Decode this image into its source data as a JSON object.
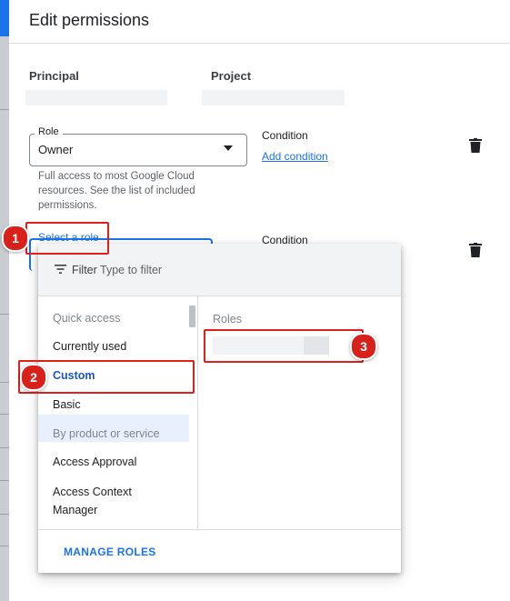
{
  "dialog": {
    "title": "Edit permissions"
  },
  "columns": {
    "principal": "Principal",
    "project": "Project"
  },
  "binding1": {
    "role_label": "Role",
    "role_value": "Owner",
    "helper_text": "Full access to most Google Cloud resources. See the list of included permissions.",
    "condition_label": "Condition",
    "add_condition": "Add condition"
  },
  "binding2": {
    "select_role": "Select a role",
    "condition_label": "Condition"
  },
  "role_picker": {
    "filter_label": "Filter",
    "filter_placeholder": "Type to filter",
    "left_items": [
      {
        "label": "Quick access",
        "type": "section"
      },
      {
        "label": "Currently used",
        "type": "item"
      },
      {
        "label": "Custom",
        "type": "item",
        "selected": true
      },
      {
        "label": "Basic",
        "type": "item"
      },
      {
        "label": "By product or service",
        "type": "section"
      },
      {
        "label": "Access Approval",
        "type": "item"
      },
      {
        "label": "Access Context Manager",
        "type": "item"
      }
    ],
    "roles_header": "Roles",
    "manage_roles": "MANAGE ROLES"
  },
  "annotations": [
    "1",
    "2",
    "3"
  ],
  "colors": {
    "accent": "#1a73e8",
    "annotation": "#d9211c",
    "selected_bg": "#e8f0fe"
  },
  "icons": {
    "delete": "trash-icon",
    "filter": "filter-icon",
    "dropdown": "caret-down-icon"
  }
}
